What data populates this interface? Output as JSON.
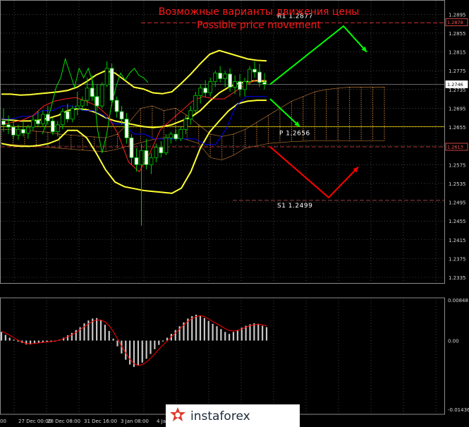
{
  "header": {
    "title_ru": "Возможные варианты движения цены",
    "title_en": "Possible price movement"
  },
  "watermark": {
    "text": "instaforex"
  },
  "colors": {
    "background": "#000000",
    "candle": "#00cc00",
    "bollinger": "#ffff33",
    "kijun": "#0000ff",
    "tenkan": "#ff2020",
    "chikou": "#00dd00",
    "cloud": "#d88a3c",
    "pivot": "#c8b400",
    "up_arrow": "#00ff00",
    "down_arrow": "#ff0000",
    "macd_hist": "#c8c8c8",
    "macd_signal": "#ff0000"
  },
  "chart_data": [
    {
      "type": "line",
      "subtype": "candlestick",
      "ylim": [
        1.2335,
        1.2915
      ],
      "grid": true,
      "y_ticks": [
        "1.2895",
        "1.2855",
        "1.2815",
        "1.2775",
        "1.2735",
        "1.2695",
        "1.2655",
        "1.2615",
        "1.2575",
        "1.2535",
        "1.2495",
        "1.2455",
        "1.2415",
        "1.2375",
        "1.2335"
      ],
      "x_ticks": [
        "00",
        "27 Dec 00:00",
        "28 Dec 08:00",
        "31 Dec 16:00",
        "3 Jan 08:00",
        "4 Jan"
      ],
      "current_price": "1.2746",
      "price_tags": [
        {
          "value": 1.2878,
          "label": "1.2878",
          "color": "#ff5555"
        },
        {
          "value": 1.2746,
          "label": "1.2746",
          "color": "#ffffff"
        },
        {
          "value": 1.2613,
          "label": "1.2613",
          "color": "#ff5555"
        }
      ],
      "levels": [
        {
          "name": "R1",
          "label": "R1 1.2877",
          "value": 1.2877
        },
        {
          "name": "P",
          "label": "P 1.2656",
          "value": 1.2656
        },
        {
          "name": "S1",
          "label": "S1 1.2499",
          "value": 1.2499
        }
      ],
      "candles": [
        [
          1.2668,
          1.2695,
          1.2645,
          1.266
        ],
        [
          1.266,
          1.268,
          1.264,
          1.2655
        ],
        [
          1.2655,
          1.2672,
          1.263,
          1.2638
        ],
        [
          1.2638,
          1.266,
          1.2628,
          1.265
        ],
        [
          1.265,
          1.2668,
          1.2635,
          1.2642
        ],
        [
          1.2642,
          1.266,
          1.263,
          1.2655
        ],
        [
          1.2655,
          1.268,
          1.2648,
          1.267
        ],
        [
          1.267,
          1.269,
          1.2655,
          1.2662
        ],
        [
          1.2662,
          1.269,
          1.2655,
          1.2682
        ],
        [
          1.2682,
          1.27,
          1.266,
          1.2668
        ],
        [
          1.2668,
          1.2675,
          1.2638,
          1.2645
        ],
        [
          1.2645,
          1.2668,
          1.2635,
          1.266
        ],
        [
          1.266,
          1.2695,
          1.265,
          1.2688
        ],
        [
          1.2688,
          1.2705,
          1.2665,
          1.2672
        ],
        [
          1.2672,
          1.27,
          1.2665,
          1.2695
        ],
        [
          1.2695,
          1.273,
          1.268,
          1.27
        ],
        [
          1.27,
          1.272,
          1.269,
          1.2712
        ],
        [
          1.2712,
          1.276,
          1.27,
          1.2738
        ],
        [
          1.2738,
          1.2765,
          1.271,
          1.272
        ],
        [
          1.272,
          1.2745,
          1.269,
          1.27
        ],
        [
          1.27,
          1.275,
          1.2695,
          1.2745
        ],
        [
          1.2745,
          1.2795,
          1.274,
          1.278
        ],
        [
          1.278,
          1.279,
          1.27,
          1.2712
        ],
        [
          1.2712,
          1.272,
          1.2675,
          1.2688
        ],
        [
          1.2688,
          1.27,
          1.266,
          1.2672
        ],
        [
          1.2672,
          1.2685,
          1.262,
          1.2632
        ],
        [
          1.2632,
          1.264,
          1.2575,
          1.259
        ],
        [
          1.259,
          1.261,
          1.256,
          1.2575
        ],
        [
          1.2575,
          1.262,
          1.2445,
          1.2605
        ],
        [
          1.2605,
          1.263,
          1.2565,
          1.2575
        ],
        [
          1.2575,
          1.26,
          1.2555,
          1.259
        ],
        [
          1.259,
          1.262,
          1.258,
          1.2612
        ],
        [
          1.2612,
          1.2625,
          1.259,
          1.26
        ],
        [
          1.26,
          1.264,
          1.2595,
          1.2632
        ],
        [
          1.2632,
          1.2645,
          1.262,
          1.264
        ],
        [
          1.264,
          1.265,
          1.2625,
          1.263
        ],
        [
          1.263,
          1.2655,
          1.2625,
          1.265
        ],
        [
          1.265,
          1.268,
          1.264,
          1.2672
        ],
        [
          1.2672,
          1.27,
          1.266,
          1.269
        ],
        [
          1.269,
          1.273,
          1.2685,
          1.2722
        ],
        [
          1.2722,
          1.2745,
          1.2705,
          1.2738
        ],
        [
          1.2738,
          1.2755,
          1.2718,
          1.2728
        ],
        [
          1.2728,
          1.276,
          1.272,
          1.2752
        ],
        [
          1.2752,
          1.2775,
          1.274,
          1.277
        ],
        [
          1.277,
          1.2785,
          1.275,
          1.2758
        ],
        [
          1.2758,
          1.2775,
          1.274,
          1.2768
        ],
        [
          1.2768,
          1.278,
          1.273,
          1.274
        ],
        [
          1.274,
          1.2765,
          1.2725,
          1.2752
        ],
        [
          1.2752,
          1.2768,
          1.272,
          1.2735
        ],
        [
          1.2735,
          1.276,
          1.272,
          1.2752
        ],
        [
          1.2752,
          1.2785,
          1.2745,
          1.2778
        ],
        [
          1.2778,
          1.2795,
          1.276,
          1.2772
        ],
        [
          1.2772,
          1.279,
          1.274,
          1.275
        ],
        [
          1.275,
          1.277,
          1.2735,
          1.2746
        ]
      ],
      "bollinger_upper": [
        1.2725,
        1.2725,
        1.2723,
        1.2724,
        1.2726,
        1.2728,
        1.273,
        1.2733,
        1.274,
        1.2752,
        1.2766,
        1.2775,
        1.277,
        1.2755,
        1.274,
        1.2736,
        1.2728,
        1.2726,
        1.273,
        1.2748,
        1.2768,
        1.279,
        1.281,
        1.2818,
        1.2812,
        1.2806,
        1.28,
        1.2797,
        1.2796
      ],
      "bollinger_middle": [
        1.2672,
        1.267,
        1.2668,
        1.2668,
        1.267,
        1.2674,
        1.268,
        1.269,
        1.2694,
        1.2692,
        1.2686,
        1.2675,
        1.2668,
        1.2664,
        1.266,
        1.2656,
        1.2654,
        1.2656,
        1.266,
        1.2668,
        1.2676,
        1.269,
        1.271,
        1.2728,
        1.274,
        1.2748,
        1.2752,
        1.2754,
        1.2752
      ],
      "bollinger_lower": [
        1.262,
        1.2616,
        1.2614,
        1.2614,
        1.2616,
        1.262,
        1.2628,
        1.2648,
        1.2648,
        1.2632,
        1.26,
        1.2564,
        1.2538,
        1.2528,
        1.2524,
        1.252,
        1.2518,
        1.2516,
        1.2514,
        1.2525,
        1.256,
        1.261,
        1.2645,
        1.2668,
        1.269,
        1.2705,
        1.271,
        1.2712,
        1.2712
      ],
      "kijun": [
        1.2672,
        1.2672,
        1.2678,
        1.2678,
        1.269,
        1.269,
        1.27,
        1.27,
        1.269,
        1.269,
        1.268,
        1.2662,
        1.2662,
        1.264,
        1.264,
        1.263,
        1.263,
        1.263,
        1.263,
        1.263,
        1.2618,
        1.2618,
        1.265,
        1.27,
        1.272,
        1.272,
        1.272
      ],
      "tenkan": [
        1.266,
        1.2665,
        1.267,
        1.268,
        1.27,
        1.271,
        1.2715,
        1.2718,
        1.271,
        1.27,
        1.268,
        1.264,
        1.258,
        1.256,
        1.26,
        1.265,
        1.267,
        1.269,
        1.271,
        1.272,
        1.2715,
        1.2715,
        1.273,
        1.2745,
        1.2755,
        1.2755
      ],
      "chikou": [
        1.264,
        1.2665,
        1.27,
        1.274,
        1.276,
        1.28,
        1.277,
        1.274,
        1.278,
        1.276,
        1.278,
        1.275,
        1.265,
        1.26,
        1.264,
        1.27,
        1.274,
        1.277,
        1.2755,
        1.277,
        1.278,
        1.2765,
        1.276,
        1.275
      ],
      "cloud_a": [
        1.265,
        1.265,
        1.2648,
        1.2646,
        1.2644,
        1.264,
        1.2638,
        1.2636,
        1.2634,
        1.2632,
        1.264,
        1.2665,
        1.2695,
        1.27,
        1.269,
        1.2695,
        1.268,
        1.266,
        1.264,
        1.2635,
        1.264,
        1.265,
        1.2665,
        1.268,
        1.2695,
        1.271,
        1.272,
        1.273,
        1.2735,
        1.2738,
        1.274,
        1.274,
        1.274,
        1.274
      ],
      "cloud_b": [
        1.262,
        1.2618,
        1.2616,
        1.2614,
        1.2612,
        1.261,
        1.2608,
        1.2606,
        1.2604,
        1.2603,
        1.2608,
        1.2615,
        1.2622,
        1.2628,
        1.2632,
        1.2634,
        1.2628,
        1.262,
        1.259,
        1.2585,
        1.2595,
        1.261,
        1.2615,
        1.262,
        1.2622,
        1.2624,
        1.2625,
        1.2626,
        1.2626,
        1.2626,
        1.2626,
        1.2626,
        1.2626,
        1.2626
      ],
      "forecast": [
        {
          "direction": "up",
          "from": 1.2746,
          "to": 1.287,
          "then": 1.2815,
          "color": "#00ff00"
        },
        {
          "direction": "down_to_pivot",
          "from": 1.2715,
          "to": 1.2656,
          "color": "#00ff00"
        },
        {
          "direction": "down",
          "from": 1.2613,
          "to": 1.2505,
          "then": 1.257,
          "color": "#ff0000"
        }
      ]
    },
    {
      "type": "bar",
      "subtype": "macd",
      "ylim": [
        -0.01436,
        0.00848
      ],
      "y_ticks": [
        "0.00848",
        "0.00",
        "-0.01436"
      ],
      "values": [
        0.0018,
        0.0012,
        0.0006,
        0.0002,
        -0.0002,
        -0.0005,
        -0.0008,
        -0.0008,
        -0.0006,
        -0.0005,
        -0.0004,
        -0.0003,
        -0.0003,
        -0.0002,
        0.0002,
        0.0006,
        0.0011,
        0.0016,
        0.0022,
        0.0028,
        0.0036,
        0.0042,
        0.0046,
        0.0047,
        0.0042,
        0.0033,
        0.002,
        0.0004,
        -0.0012,
        -0.0027,
        -0.004,
        -0.005,
        -0.0055,
        -0.0052,
        -0.0046,
        -0.0038,
        -0.0028,
        -0.0018,
        -0.0009,
        -0.0002,
        0.0006,
        0.0014,
        0.0022,
        0.003,
        0.0038,
        0.0046,
        0.0051,
        0.0054,
        0.0052,
        0.0047,
        0.0041,
        0.0035,
        0.003,
        0.0024,
        0.0018,
        0.0014,
        0.0018,
        0.0022,
        0.0027,
        0.0031,
        0.0034,
        0.0036,
        0.0035,
        0.0031,
        0.0028
      ],
      "signal": [
        0.0019,
        0.0016,
        0.0011,
        0.0006,
        0.0001,
        -0.0003,
        -0.0006,
        -0.0007,
        -0.0006,
        -0.0005,
        -0.0004,
        -0.0003,
        -0.0002,
        -0.0001,
        0.0001,
        0.0004,
        0.0008,
        0.0012,
        0.0017,
        0.0023,
        0.0029,
        0.0035,
        0.004,
        0.0043,
        0.0043,
        0.0039,
        0.0031,
        0.0019,
        0.0004,
        -0.0012,
        -0.0026,
        -0.0039,
        -0.0048,
        -0.0052,
        -0.005,
        -0.0045,
        -0.0037,
        -0.0028,
        -0.0018,
        -0.0009,
        -0.0001,
        0.0008,
        0.0016,
        0.0024,
        0.0032,
        0.004,
        0.0046,
        0.005,
        0.0052,
        0.005,
        0.0045,
        0.004,
        0.0035,
        0.003,
        0.0025,
        0.0021,
        0.002,
        0.0021,
        0.0024,
        0.0028,
        0.0031,
        0.0033,
        0.0034,
        0.0033,
        0.0031
      ]
    }
  ]
}
